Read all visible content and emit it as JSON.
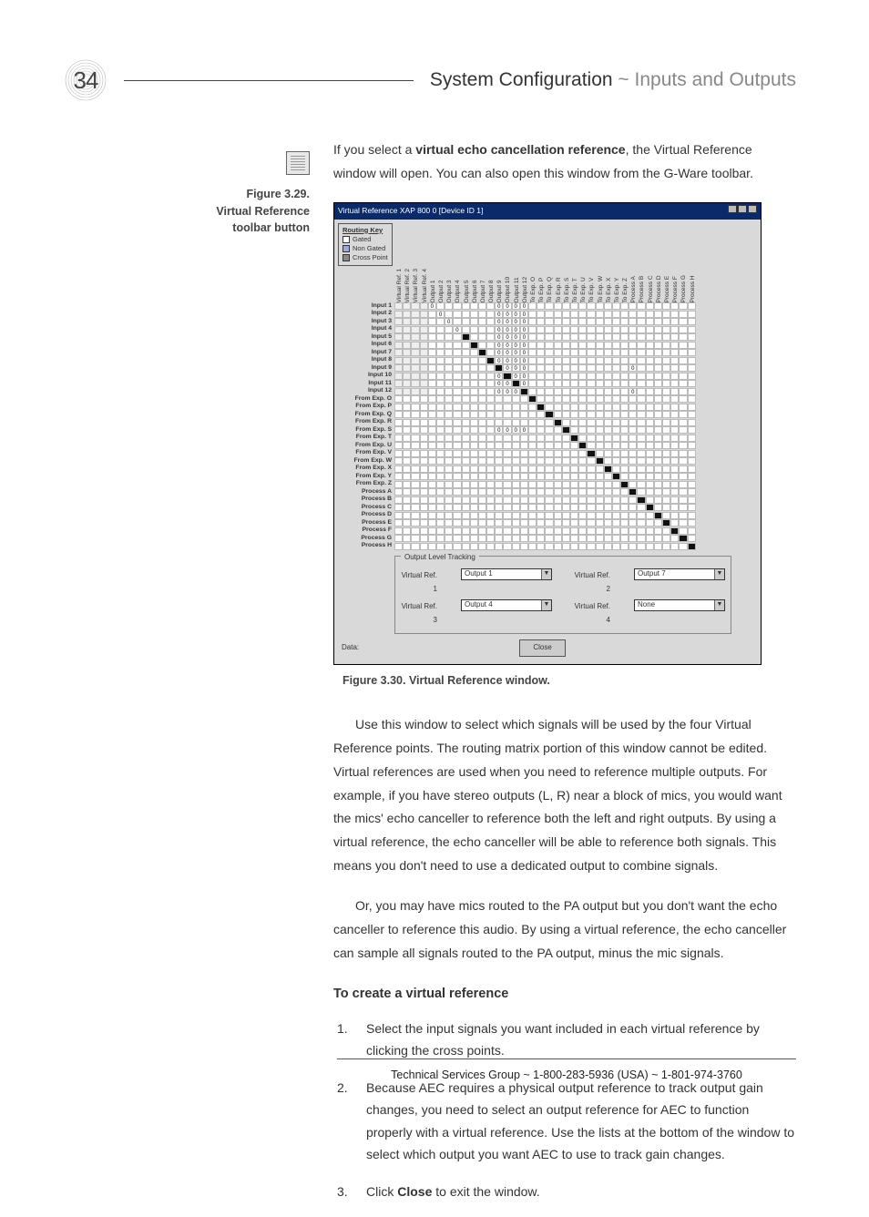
{
  "page_number": "34",
  "header": {
    "section": "System Configuration",
    "tilde": "~",
    "subsection": "Inputs and Outputs"
  },
  "margin": {
    "fig_label": "Figure 3.29.",
    "fig_title_l1": "Virtual Reference",
    "fig_title_l2": "toolbar button"
  },
  "intro_p1_a": "If you select a ",
  "intro_bold": "virtual echo cancellation reference",
  "intro_p1_b": ", the Virtual Reference window will open. You can also open this window from the G-Ware toolbar.",
  "vr_window": {
    "title": "Virtual Reference XAP 800 0 [Device ID 1]",
    "routing_key_title": "Routing Key",
    "routing_key_items": [
      "Gated",
      "Non Gated",
      "Cross Point"
    ],
    "col_headers": [
      "Virtual Ref. 1",
      "Virtual Ref. 2",
      "Virtual Ref. 3",
      "Virtual Ref. 4",
      "Output 1",
      "Output 2",
      "Output 3",
      "Output 4",
      "Output 5",
      "Output 6",
      "Output 7",
      "Output 8",
      "Output 9",
      "Output 10",
      "Output 11",
      "Output 12",
      "To Exp. O",
      "To Exp. P",
      "To Exp. Q",
      "To Exp. R",
      "To Exp. S",
      "To Exp. T",
      "To Exp. U",
      "To Exp. V",
      "To Exp. W",
      "To Exp. X",
      "To Exp. Y",
      "To Exp. Z",
      "Process A",
      "Process B",
      "Process C",
      "Process D",
      "Process E",
      "Process F",
      "Process G",
      "Process H"
    ],
    "row_labels": [
      "Input 1",
      "Input 2",
      "Input 3",
      "Input 4",
      "Input 5",
      "Input 6",
      "Input 7",
      "Input 8",
      "Input 9",
      "Input 10",
      "Input 11",
      "Input 12",
      "From Exp. O",
      "From Exp. P",
      "From Exp. Q",
      "From Exp. R",
      "From Exp. S",
      "From Exp. T",
      "From Exp. U",
      "From Exp. V",
      "From Exp. W",
      "From Exp. X",
      "From Exp. Y",
      "From Exp. Z",
      "Process A",
      "Process B",
      "Process C",
      "Process D",
      "Process E",
      "Process F",
      "Process G",
      "Process H"
    ],
    "olt_title": "Output Level Tracking",
    "olt_rows": [
      {
        "label": "Virtual Ref. 1",
        "value": "Output 1"
      },
      {
        "label": "Virtual Ref. 2",
        "value": "Output 7"
      },
      {
        "label": "Virtual Ref. 3",
        "value": "Output 4"
      },
      {
        "label": "Virtual Ref. 4",
        "value": "None"
      }
    ],
    "data_label": "Data:",
    "close": "Close"
  },
  "fig_caption": "Figure 3.30. Virtual Reference window.",
  "para2": "Use this window to select which signals will be used by the four Virtual Reference points. The routing matrix portion of this window cannot be edited. Virtual references are used when you need to reference multiple outputs. For example, if you have stereo outputs (L, R) near a block of mics, you would want the mics' echo canceller to reference both the left and right outputs. By using a virtual reference, the echo canceller will be able to reference both signals. This means you don't need to use a dedicated output to combine signals.",
  "para3": "Or, you may have mics routed to the PA output but you don't want the echo canceller to reference this audio. By using a virtual reference, the echo canceller can sample all signals routed to the PA output, minus the mic signals.",
  "subhead": "To create a virtual reference",
  "steps": [
    "Select the input signals you want included in each virtual reference by clicking the cross points.",
    "Because AEC requires a physical output reference to track output gain changes, you need to select an output reference for AEC to function properly with a virtual reference. Use the lists at the bottom of the window to select which output you want AEC to use to track gain changes.",
    "Click Close to exit the window."
  ],
  "step3_prefix": "Click ",
  "step3_bold": "Close",
  "step3_suffix": " to exit the window.",
  "footer": "Technical Services Group ~ 1-800-283-5936 (USA) ~ 1-801-974-3760"
}
